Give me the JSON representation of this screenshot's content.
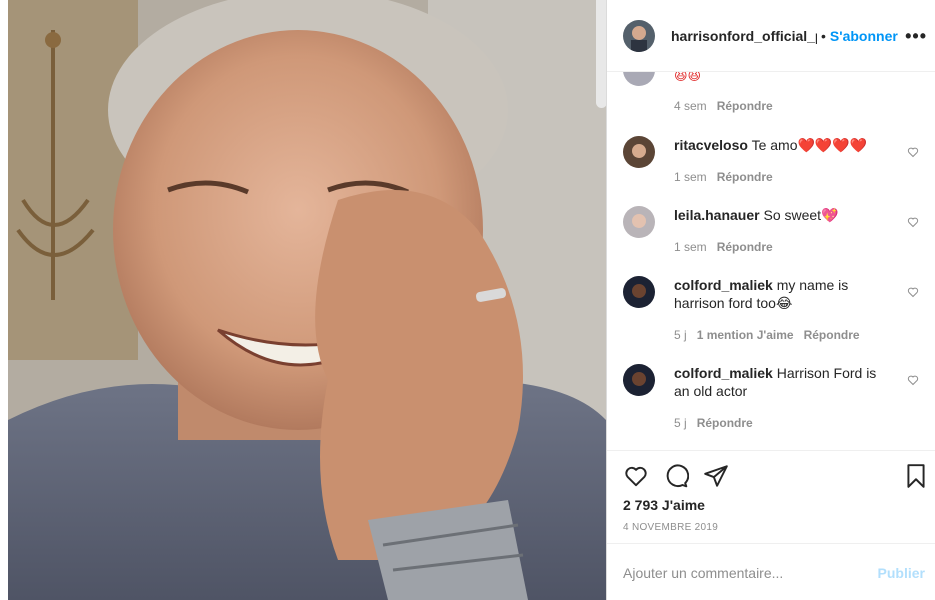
{
  "post": {
    "username": "harrisonford_official_p...",
    "dot": "•",
    "follow_label": "S'abonner",
    "more_label": "•••"
  },
  "comments": [
    {
      "user": "",
      "text": "😆😆",
      "time": "4 sem",
      "likes": "",
      "reply": "Répondre",
      "partial": true
    },
    {
      "user": "ritacveloso",
      "text": "Te amo❤️❤️❤️❤️",
      "time": "1 sem",
      "likes": "",
      "reply": "Répondre"
    },
    {
      "user": "leila.hanauer",
      "text": "So sweet💖",
      "time": "1 sem",
      "likes": "",
      "reply": "Répondre"
    },
    {
      "user": "colford_maliek",
      "text": "my name is harrison ford too😂",
      "time": "5 j",
      "likes": "1 mention J'aime",
      "reply": "Répondre"
    },
    {
      "user": "colford_maliek",
      "text": "Harrison Ford is an old actor",
      "time": "5 j",
      "likes": "",
      "reply": "Répondre"
    }
  ],
  "stats": {
    "likes": "2 793 J'aime",
    "date": "4 NOVEMBRE 2019"
  },
  "composer": {
    "placeholder": "Ajouter un commentaire...",
    "publish_label": "Publier"
  },
  "icons": {
    "like": "heart-icon",
    "comment": "comment-icon",
    "share": "paper-plane-icon",
    "save": "bookmark-icon",
    "comment_like": "small-heart-icon",
    "more": "ellipsis-icon"
  },
  "colors": {
    "accent": "#0095f6",
    "publish_disabled": "#b2dffc",
    "muted": "#8e8e8e",
    "text": "#262626"
  }
}
